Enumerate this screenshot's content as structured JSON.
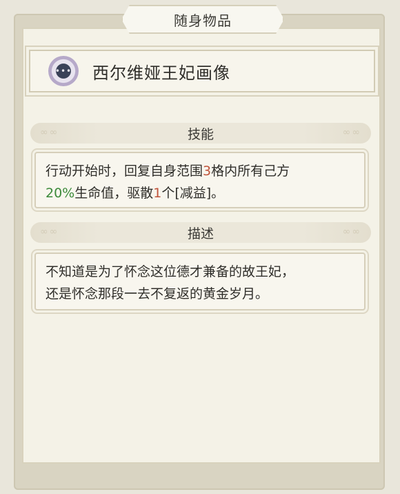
{
  "title": "随身物品",
  "item": {
    "name": "西尔维娅王妃画像",
    "icon": "portrait-orb-icon"
  },
  "skill": {
    "header": "技能",
    "parts": {
      "p1": "行动开始时，回复自身范围",
      "n1": "3",
      "p2": "格内所有己方",
      "n2": "20%",
      "p3": "生命值，驱散",
      "n3": "1",
      "p4": "个[减益]。"
    }
  },
  "description": {
    "header": "描述",
    "line1": "不知道是为了怀念这位德才兼备的故王妃，",
    "line2": "还是怀念那段一去不复返的黄金岁月。"
  },
  "colors": {
    "highlight_red": "#c0543b",
    "highlight_green": "#3c8a3a"
  }
}
